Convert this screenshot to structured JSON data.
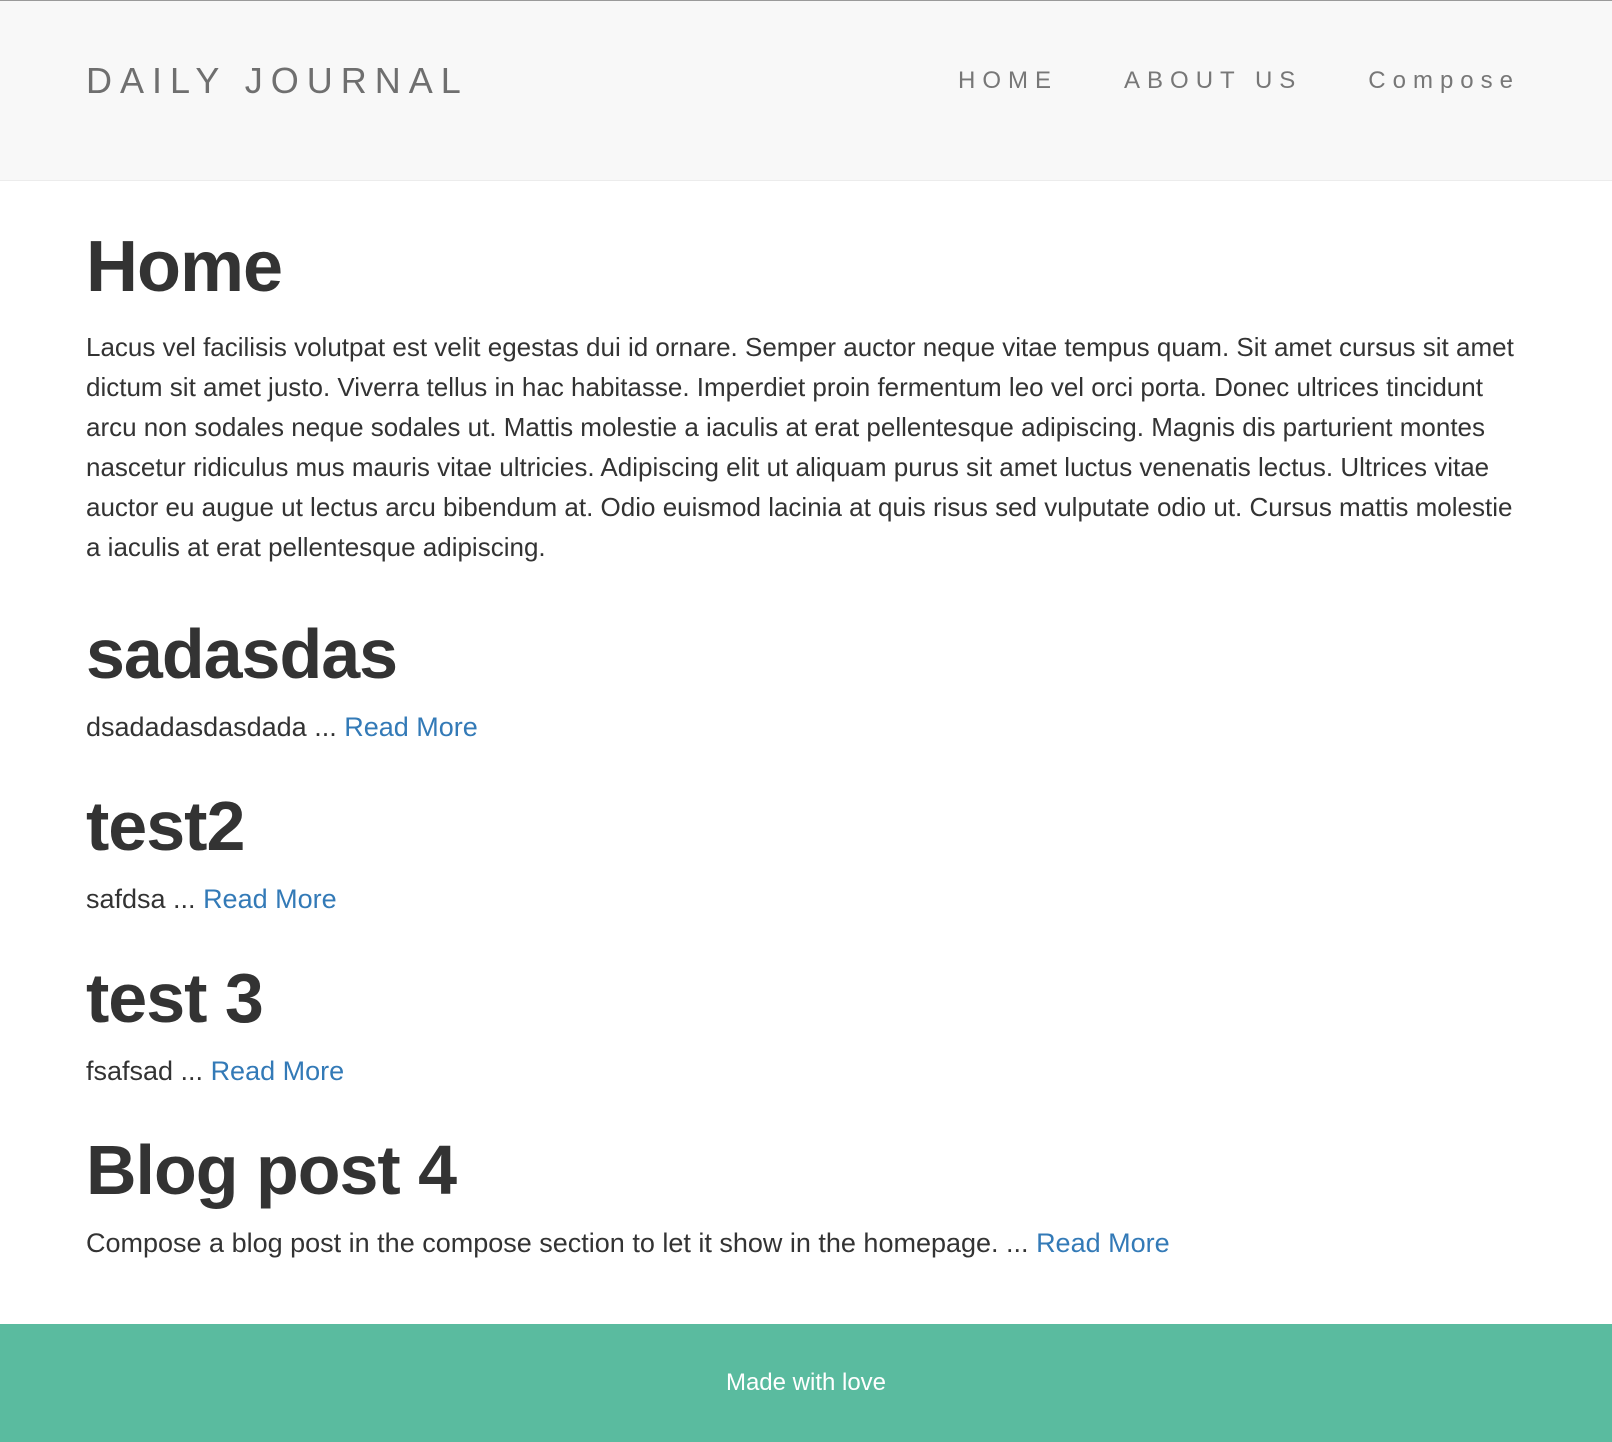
{
  "navbar": {
    "brand": "DAILY JOURNAL",
    "links": [
      {
        "label": "HOME"
      },
      {
        "label": "ABOUT US"
      },
      {
        "label": "Compose"
      }
    ]
  },
  "main": {
    "title": "Home",
    "intro": "Lacus vel facilisis volutpat est velit egestas dui id ornare. Semper auctor neque vitae tempus quam. Sit amet cursus sit amet dictum sit amet justo. Viverra tellus in hac habitasse. Imperdiet proin fermentum leo vel orci porta. Donec ultrices tincidunt arcu non sodales neque sodales ut. Mattis molestie a iaculis at erat pellentesque adipiscing. Magnis dis parturient montes nascetur ridiculus mus mauris vitae ultricies. Adipiscing elit ut aliquam purus sit amet luctus venenatis lectus. Ultrices vitae auctor eu augue ut lectus arcu bibendum at. Odio euismod lacinia at quis risus sed vulputate odio ut. Cursus mattis molestie a iaculis at erat pellentesque adipiscing.",
    "posts": [
      {
        "title": "sadasdas",
        "excerpt": "dsadadasdasdada ... ",
        "read_more": "Read More"
      },
      {
        "title": "test2",
        "excerpt": "safdsa ... ",
        "read_more": "Read More"
      },
      {
        "title": "test 3",
        "excerpt": "fsafsad ... ",
        "read_more": "Read More"
      },
      {
        "title": "Blog post 4",
        "excerpt": "Compose a blog post in the compose section to let it show in the homepage. ... ",
        "read_more": "Read More"
      }
    ]
  },
  "footer": {
    "text": "Made with love"
  },
  "colors": {
    "navbar_bg": "#f8f8f8",
    "link": "#337ab7",
    "footer_bg": "#5abb9f",
    "text": "#333333"
  }
}
